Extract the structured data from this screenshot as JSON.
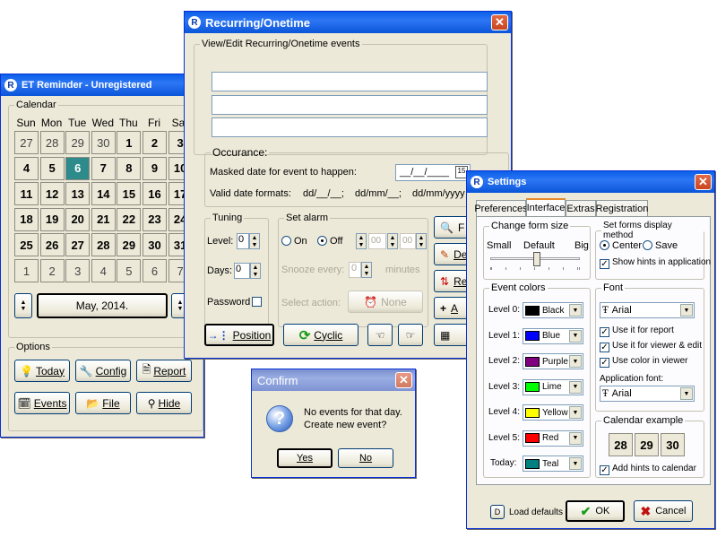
{
  "et_window": {
    "title": "ET Reminder - Unregistered",
    "calendar_label": "Calendar",
    "weekdays": [
      "Sun",
      "Mon",
      "Tue",
      "Wed",
      "Thu",
      "Fri",
      "Sat"
    ],
    "rows": [
      [
        "27",
        "28",
        "29",
        "30",
        "1",
        "2",
        "3"
      ],
      [
        "4",
        "5",
        "6",
        "7",
        "8",
        "9",
        "10"
      ],
      [
        "11",
        "12",
        "13",
        "14",
        "15",
        "16",
        "17"
      ],
      [
        "18",
        "19",
        "20",
        "21",
        "22",
        "23",
        "24"
      ],
      [
        "25",
        "26",
        "27",
        "28",
        "29",
        "30",
        "31"
      ],
      [
        "1",
        "2",
        "3",
        "4",
        "5",
        "6",
        "7"
      ]
    ],
    "month_label": "May, 2014.",
    "options_label": "Options",
    "buttons": {
      "today": "Today",
      "config": "Config",
      "report": "Report",
      "events": "Events",
      "file": "File",
      "hide": "Hide"
    }
  },
  "recurring": {
    "title": "Recurring/Onetime",
    "group_label": "View/Edit Recurring/Onetime events",
    "occurance_label": "Occurance:",
    "masked_date_label": "Masked date for event to happen:",
    "masked_date_value": "__/__/____",
    "valid_formats_label": "Valid date formats:",
    "formats": [
      "dd/__/__;",
      "dd/mm/__;",
      "dd/mm/yyyy"
    ],
    "tuning_label": "Tuning",
    "level_label": "Level:",
    "level_value": "0",
    "days_label": "Days:",
    "days_value": "0",
    "password_label": "Password",
    "alarm_label": "Set alarm",
    "on_label": "On",
    "off_label": "Off",
    "hour_value": "00",
    "min_value": "00",
    "snooze_label": "Snooze every:",
    "snooze_value": "0",
    "minutes_label": "minutes",
    "select_action_label": "Select action:",
    "none_label": "None",
    "position_label": "Position",
    "cyclic_label": "Cyclic",
    "side_buttons": [
      "F",
      "De",
      "Re",
      "A",
      ""
    ]
  },
  "confirm": {
    "title": "Confirm",
    "message_line1": "No events for that day.",
    "message_line2": "Create new event?",
    "yes": "Yes",
    "no": "No"
  },
  "settings": {
    "title": "Settings",
    "tabs": [
      "Preferences",
      "Interface",
      "Extras",
      "Registration"
    ],
    "form_size_label": "Change form size",
    "size_small": "Small",
    "size_default": "Default",
    "size_big": "Big",
    "display_method_label": "Set forms display method",
    "center_label": "Center",
    "save_label": "Save",
    "show_hints_label": "Show hints in application",
    "event_colors_label": "Event colors",
    "levels": [
      {
        "label": "Level 0:",
        "color_name": "Black",
        "color": "#000000"
      },
      {
        "label": "Level 1:",
        "color_name": "Blue",
        "color": "#0000ff"
      },
      {
        "label": "Level 2:",
        "color_name": "Purple",
        "color": "#800080"
      },
      {
        "label": "Level 3:",
        "color_name": "Lime",
        "color": "#00ff00"
      },
      {
        "label": "Level 4:",
        "color_name": "Yellow",
        "color": "#ffff00"
      },
      {
        "label": "Level 5:",
        "color_name": "Red",
        "color": "#ff0000"
      },
      {
        "label": "Today:",
        "color_name": "Teal",
        "color": "#008080"
      }
    ],
    "font_label": "Font",
    "font_value": "Arial",
    "use_report": "Use it for report",
    "use_viewer": "Use it for viewer & edit",
    "use_color": "Use color in viewer",
    "app_font_label": "Application font:",
    "app_font_value": "Arial",
    "cal_example_label": "Calendar example",
    "cal_days": [
      "28",
      "29",
      "30"
    ],
    "add_hints_label": "Add hints to calendar",
    "load_defaults_key": "D",
    "load_defaults": "Load defaults",
    "ok": "OK",
    "cancel": "Cancel"
  }
}
